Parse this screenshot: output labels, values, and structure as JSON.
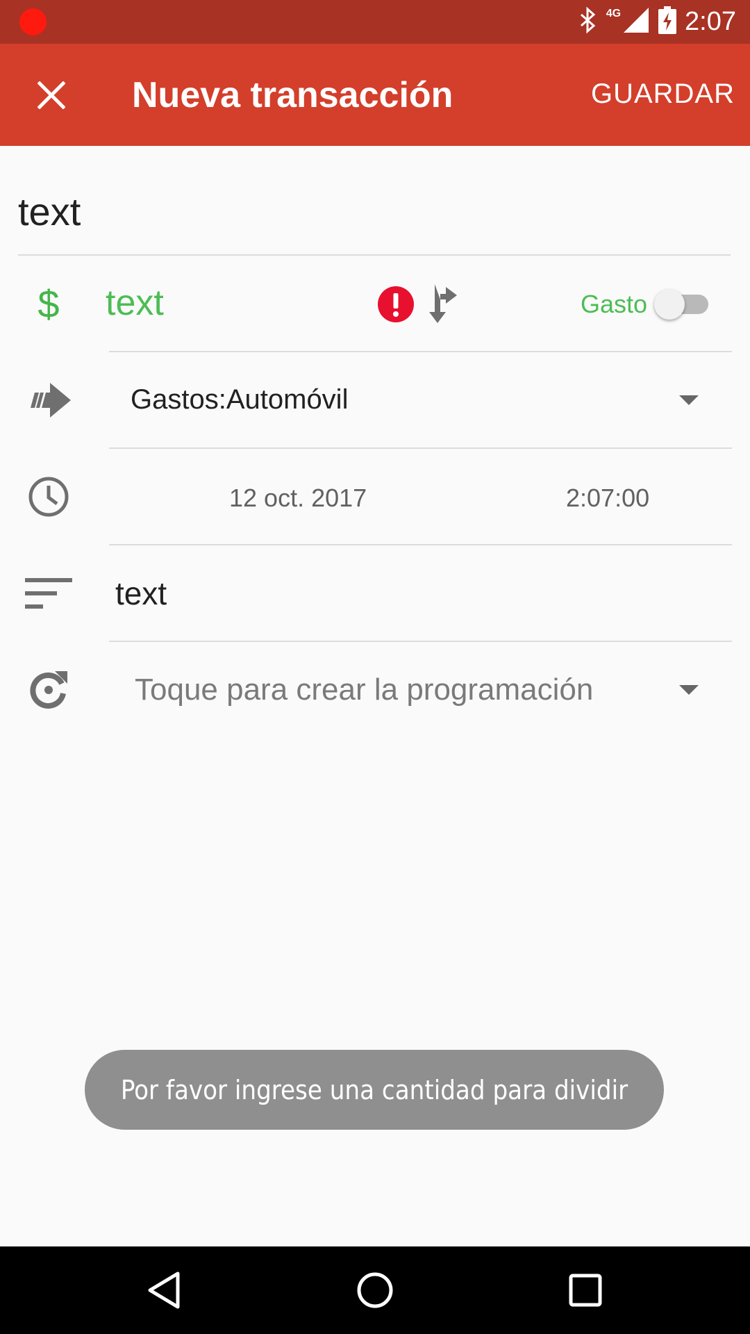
{
  "status_bar": {
    "time": "2:07",
    "network": "4G"
  },
  "app_bar": {
    "title": "Nueva transacción",
    "save_label": "GUARDAR"
  },
  "description": {
    "value": "text"
  },
  "amount": {
    "currency_symbol": "$",
    "value": "text",
    "type_label": "Gasto",
    "type_toggle_on": false
  },
  "account": {
    "value": "Gastos:Automóvil"
  },
  "datetime": {
    "date": "12 oct. 2017",
    "time": "2:07:00"
  },
  "notes": {
    "value": "text"
  },
  "recurrence": {
    "value": "Toque para crear la programación"
  },
  "toast": {
    "message": "Por favor ingrese una cantidad para dividir"
  },
  "colors": {
    "status_bar": "#a83224",
    "app_bar": "#d33f2b",
    "accent_green": "#4cbd54",
    "error_red": "#e8102f"
  }
}
